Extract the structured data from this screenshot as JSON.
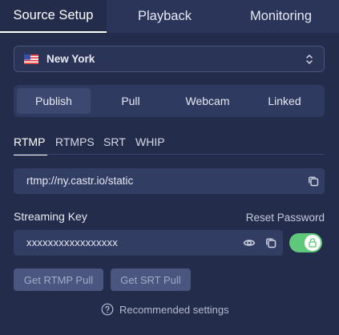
{
  "top_tabs": [
    {
      "label": "Source Setup",
      "active": true
    },
    {
      "label": "Playback",
      "active": false
    },
    {
      "label": "Monitoring",
      "active": false
    }
  ],
  "region": {
    "flag_icon": "us-flag-icon",
    "label": "New York"
  },
  "modes": [
    {
      "label": "Publish",
      "active": true
    },
    {
      "label": "Pull",
      "active": false
    },
    {
      "label": "Webcam",
      "active": false
    },
    {
      "label": "Linked",
      "active": false
    }
  ],
  "protocols": [
    {
      "label": "RTMP",
      "active": true
    },
    {
      "label": "RTMPS",
      "active": false
    },
    {
      "label": "SRT",
      "active": false
    },
    {
      "label": "WHIP",
      "active": false
    }
  ],
  "server_url": "rtmp://ny.castr.io/static",
  "streaming_key": {
    "label": "Streaming Key",
    "reset_label": "Reset Password",
    "value": "xxxxxxxxxxxxxxxxx",
    "locked": true
  },
  "buttons": {
    "rtmp_pull": "Get RTMP Pull",
    "srt_pull": "Get SRT Pull"
  },
  "recommended": "Recommended settings",
  "colors": {
    "accent_green": "#5fc87a",
    "background": "#232c4a"
  }
}
